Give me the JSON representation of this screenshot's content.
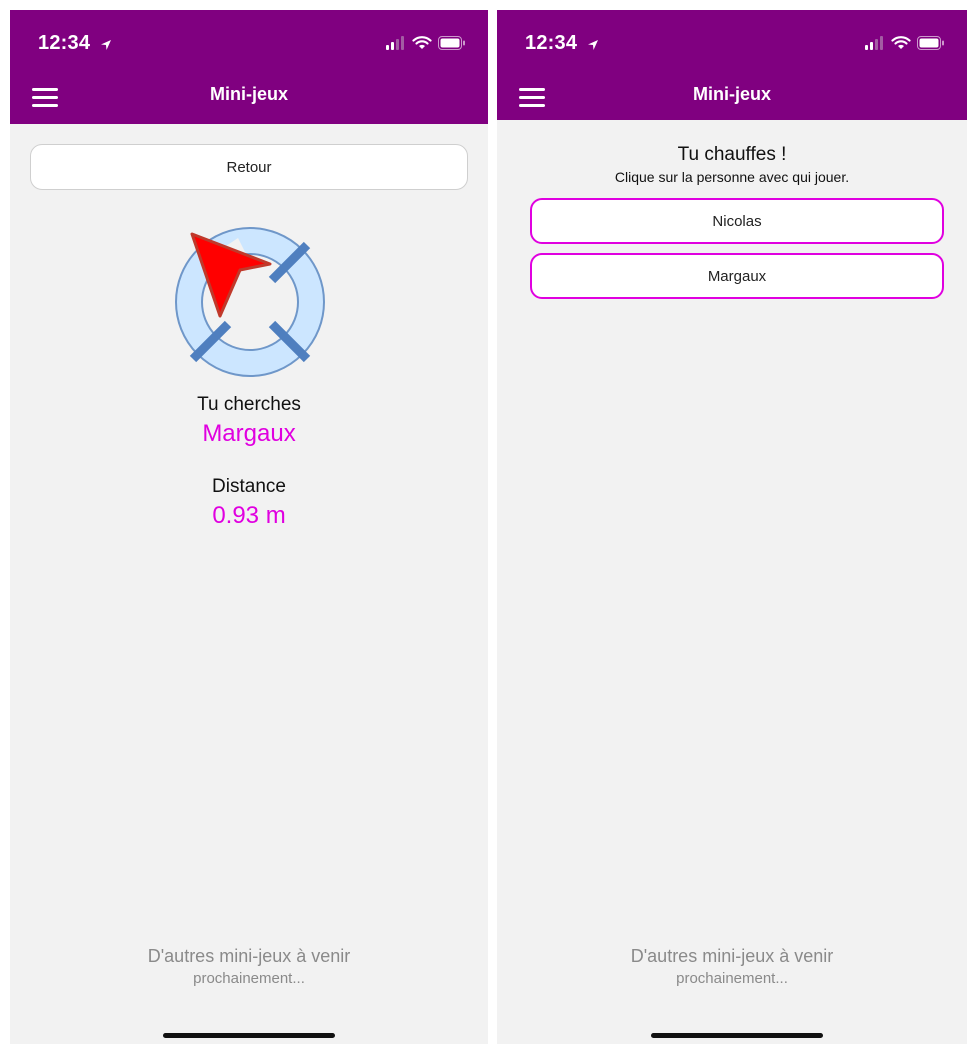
{
  "left_screen": {
    "status": {
      "time": "12:34"
    },
    "header": {
      "title": "Mini-jeux"
    },
    "back_button_label": "Retour",
    "search": {
      "label": "Tu cherches",
      "target": "Margaux"
    },
    "distance": {
      "label": "Distance",
      "value": "0.93 m"
    },
    "footer": {
      "line1": "D'autres mini-jeux à venir",
      "line2": "prochainement..."
    }
  },
  "right_screen": {
    "status": {
      "time": "12:34"
    },
    "header": {
      "title": "Mini-jeux"
    },
    "heading": "Tu chauffes !",
    "subheading": "Clique sur la personne avec qui jouer.",
    "people": [
      "Nicolas",
      "Margaux"
    ],
    "footer": {
      "line1": "D'autres mini-jeux à venir",
      "line2": "prochainement..."
    }
  },
  "colors": {
    "header_bg": "#800080",
    "accent_pink": "#e000e0",
    "compass_ring": "#cce6ff",
    "compass_stroke": "#6f97c9",
    "arrow_fill": "#ff0000"
  },
  "icons": [
    "location-arrow-icon",
    "signal-icon",
    "wifi-icon",
    "battery-icon",
    "hamburger-menu-icon",
    "compass-icon"
  ]
}
